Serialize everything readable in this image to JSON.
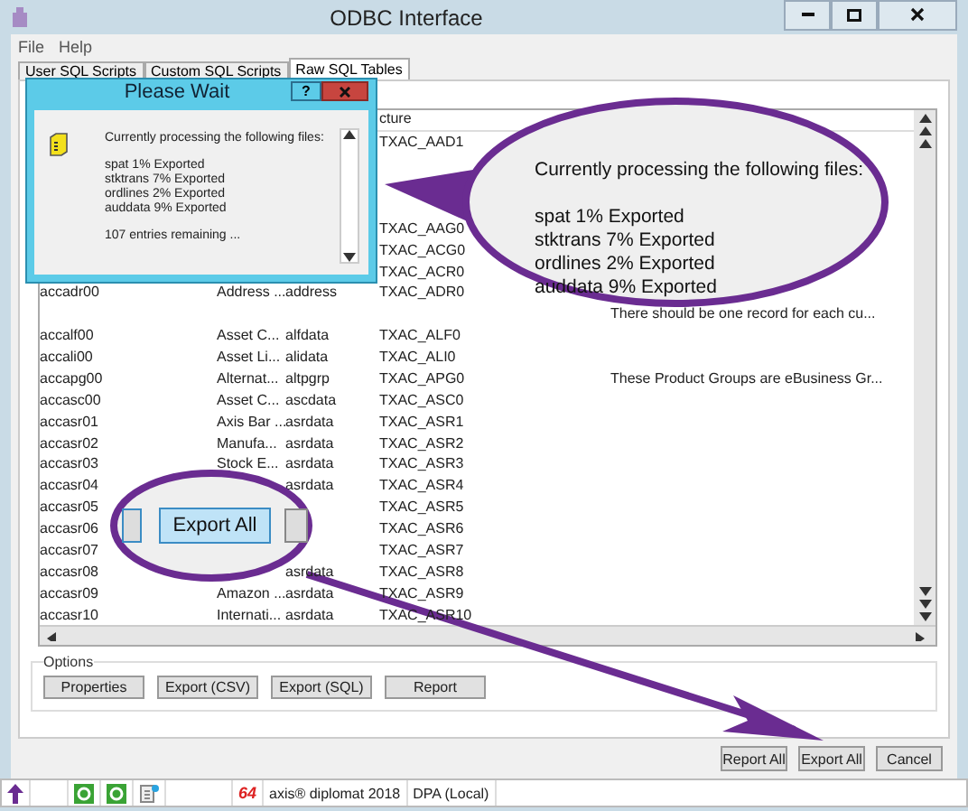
{
  "window": {
    "title": "ODBC Interface"
  },
  "menu": [
    "File",
    "Help"
  ],
  "tabs": [
    {
      "label": "User SQL Scripts",
      "selected": false
    },
    {
      "label": "Custom SQL Scripts",
      "selected": false
    },
    {
      "label": "Raw SQL Tables",
      "selected": true
    }
  ],
  "table": {
    "header_4": "cture",
    "rows": [
      {
        "structure": "TXAC_AAD1"
      },
      {},
      {},
      {},
      {
        "structure": "TXAC_AAG0"
      },
      {
        "structure": "TXAC_ACG0"
      },
      {
        "structure": "TXAC_ACR0"
      },
      {
        "name": "accadr00",
        "description": "Address ...",
        "data": "address",
        "structure": "TXAC_ADR0"
      },
      {
        "note": "There should be one record for each cu..."
      },
      {
        "name": "accalf00",
        "description": "Asset C...",
        "data": "alfdata",
        "structure": "TXAC_ALF0"
      },
      {
        "name": "accali00",
        "description": "Asset Li...",
        "data": "alidata",
        "structure": "TXAC_ALI0"
      },
      {
        "name": "accapg00",
        "description": "Alternat...",
        "data": "altpgrp",
        "structure": "TXAC_APG0",
        "note": "These Product Groups are eBusiness Gr..."
      },
      {
        "name": "accasc00",
        "description": "Asset C...",
        "data": "ascdata",
        "structure": "TXAC_ASC0"
      },
      {
        "name": "accasr01",
        "description": "Axis Bar ...",
        "data": "asrdata",
        "structure": "TXAC_ASR1"
      },
      {
        "name": "accasr02",
        "description": "Manufa...",
        "data": "asrdata",
        "structure": "TXAC_ASR2"
      },
      {
        "name": "accasr03",
        "description": "Stock E...",
        "data": "asrdata",
        "structure": "TXAC_ASR3"
      },
      {
        "name": "accasr04",
        "data": "asrdata",
        "structure": "TXAC_ASR4"
      },
      {
        "name": "accasr05",
        "structure": "TXAC_ASR5"
      },
      {
        "name": "accasr06",
        "structure": "TXAC_ASR6"
      },
      {
        "name": "accasr07",
        "structure": "TXAC_ASR7"
      },
      {
        "name": "accasr08",
        "data": "asrdata",
        "structure": "TXAC_ASR8"
      },
      {
        "name": "accasr09",
        "description": "Amazon ...",
        "data": "asrdata",
        "structure": "TXAC_ASR9"
      },
      {
        "name": "accasr10",
        "description": "Internati...",
        "data": "asrdata",
        "structure": "TXAC_ASR10"
      }
    ]
  },
  "options": {
    "title": "Options",
    "buttons": [
      "Properties",
      "Export (CSV)",
      "Export (SQL)",
      "Report"
    ]
  },
  "buttons": [
    "Report All",
    "Export All",
    "Cancel"
  ],
  "status_bar": {
    "badge": "64",
    "product": "axis® diplomat 2018",
    "connection": "DPA (Local)"
  },
  "dialog": {
    "title": "Please Wait",
    "help": "?",
    "heading": "Currently processing the following files:",
    "files": [
      "spat 1% Exported",
      "stktrans 7% Exported",
      "ordlines 2% Exported",
      "auddata 9% Exported"
    ],
    "remaining": "107 entries remaining ..."
  },
  "callout": {
    "heading": "Currently processing the following files:",
    "files": [
      "spat 1% Exported",
      "stktrans 7% Exported",
      "ordlines 2% Exported",
      "auddata 9% Exported"
    ]
  },
  "zoom_callout": {
    "button": "Export All"
  }
}
